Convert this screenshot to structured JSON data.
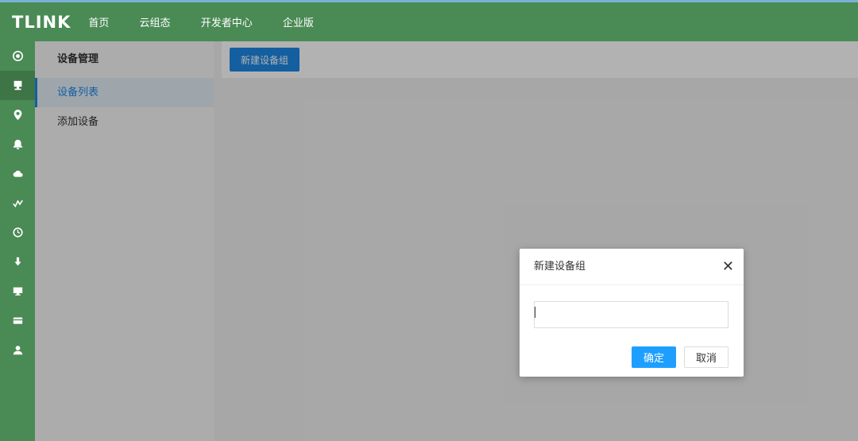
{
  "app": {
    "logo": "TLINK"
  },
  "topnav": [
    "首页",
    "云组态",
    "开发者中心",
    "企业版"
  ],
  "iconbar": [
    "overview-icon",
    "device-icon",
    "location-icon",
    "alarm-icon",
    "cloud-icon",
    "data-trend-icon",
    "history-icon",
    "download-icon",
    "screen-icon",
    "card-icon",
    "user-icon"
  ],
  "sidebar": {
    "title": "设备管理",
    "items": [
      {
        "label": "设备列表",
        "active": true
      },
      {
        "label": "添加设备",
        "active": false
      }
    ]
  },
  "toolbar": {
    "new_group_label": "新建设备组"
  },
  "modal": {
    "title": "新建设备组",
    "input_value": "",
    "ok_label": "确定",
    "cancel_label": "取消"
  },
  "colors": {
    "brand_green": "#4a8a55",
    "primary_blue": "#1e88e5",
    "ok_blue": "#1e9fff"
  }
}
